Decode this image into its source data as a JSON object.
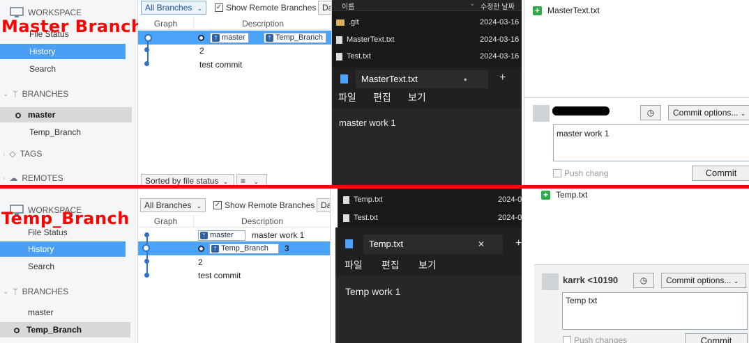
{
  "top": {
    "overlay_title": "Master Branch",
    "sidebar": {
      "workspace": "WORKSPACE",
      "file_status": "File Status",
      "history": "History",
      "search": "Search",
      "branches": "BRANCHES",
      "branch_items": [
        "master",
        "Temp_Branch"
      ],
      "tags": "TAGS",
      "remotes": "REMOTES"
    },
    "history": {
      "branch_filter": "All Branches",
      "show_remote": "Show Remote Branches",
      "cut_button": "Da",
      "col_graph": "Graph",
      "col_desc": "Description",
      "rows": [
        {
          "tags": [
            "master",
            "Temp_Branch"
          ],
          "desc": ""
        },
        {
          "tags": [],
          "desc": "2"
        },
        {
          "tags": [],
          "desc": "test commit"
        }
      ],
      "sort_label": "Sorted by file status",
      "view_label": "≡"
    },
    "explorer": {
      "col_name": "이름",
      "col_modified": "수정한 날짜",
      "files": [
        {
          "name": ".git",
          "date": "2024-03-16",
          "kind": "folder"
        },
        {
          "name": "MasterText.txt",
          "date": "2024-03-16",
          "kind": "file"
        },
        {
          "name": "Test.txt",
          "date": "2024-03-16",
          "kind": "file"
        }
      ]
    },
    "notepad": {
      "tab_title": "MasterText.txt",
      "tab_state": "●",
      "new_tab": "+",
      "menu": [
        "파일",
        "편집",
        "보기"
      ],
      "content": "master work 1"
    },
    "commit": {
      "staged_file": "MasterText.txt",
      "options": "Commit options...",
      "message": "master work 1",
      "push": "Push chang",
      "commit_btn": "Commit"
    }
  },
  "bottom": {
    "overlay_title": "Temp_Branch",
    "sidebar": {
      "workspace": "WORKSPACE",
      "file_status": "File Status",
      "history": "History",
      "search": "Search",
      "branches": "BRANCHES",
      "branch_items": [
        "master",
        "Temp_Branch"
      ]
    },
    "history": {
      "branch_filter": "All Branches",
      "show_remote": "Show Remote Branches",
      "cut_button": "Da",
      "col_graph": "Graph",
      "col_desc": "Description",
      "rows": [
        {
          "tags": [
            "master"
          ],
          "desc": "master work 1"
        },
        {
          "tags": [
            "Temp_Branch"
          ],
          "desc": "3"
        },
        {
          "tags": [],
          "desc": "2"
        },
        {
          "tags": [],
          "desc": "test commit"
        }
      ]
    },
    "explorer": {
      "files": [
        {
          "name": "Temp.txt",
          "date": "2024-0",
          "kind": "file"
        },
        {
          "name": "Test.txt",
          "date": "2024-0",
          "kind": "file"
        }
      ]
    },
    "notepad": {
      "tab_title": "Temp.txt",
      "close": "✕",
      "new_tab": "+",
      "menu": [
        "파일",
        "편집",
        "보기"
      ],
      "content": "Temp work 1"
    },
    "commit": {
      "staged_file": "Temp.txt",
      "author": "karrk <10190",
      "options": "Commit options...",
      "message": "Temp txt",
      "push": "Push changes",
      "commit_btn": "Commit"
    }
  },
  "colors": {
    "accent": "#4a9ff5",
    "divider": "#ff0000",
    "overlay_text": "#ff0000",
    "staged_icon": "#2eaa4a"
  }
}
